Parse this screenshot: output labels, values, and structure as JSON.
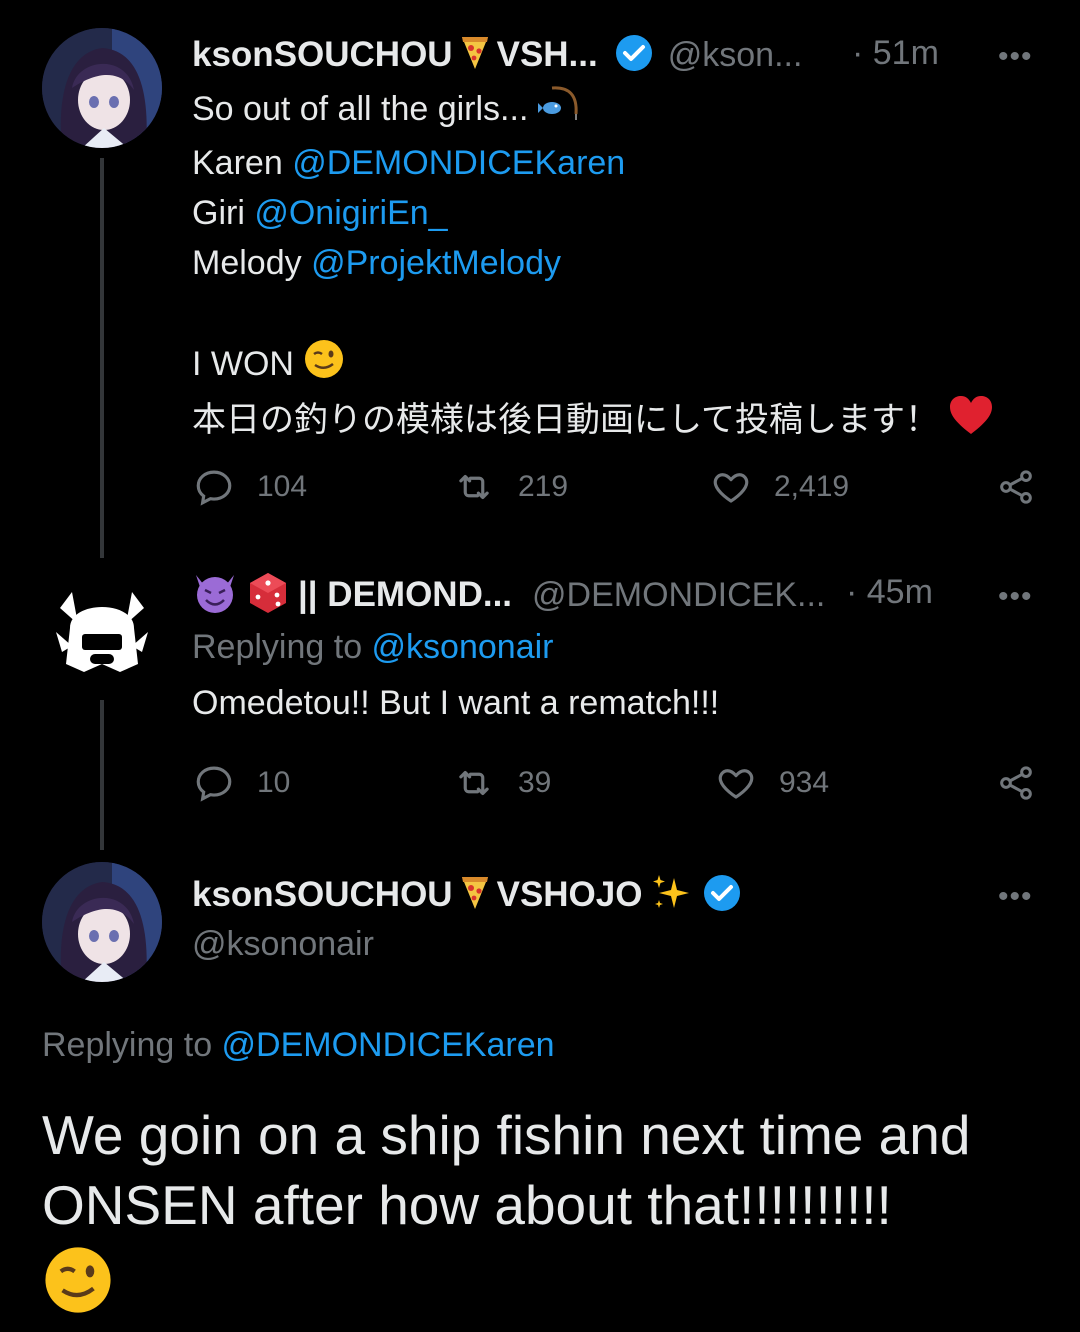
{
  "tweet1": {
    "display_name": "ksonSOUCHOU",
    "display_name_suffix": "VSH...",
    "handle": "@kson...",
    "time": "· 51m",
    "more": "•••",
    "lines": [
      {
        "text": "So out of all the girls...",
        "mention": ""
      },
      {
        "text": "Karen ",
        "mention": "@DEMONDICEKaren"
      },
      {
        "text": "Giri ",
        "mention": "@OnigiriEn_"
      },
      {
        "text": "Melody ",
        "mention": "@ProjektMelody"
      },
      {
        "text": "I WON",
        "mention": ""
      },
      {
        "text": "本日の釣りの模様は後日動画にして投稿します！",
        "mention": ""
      }
    ],
    "stats": {
      "replies": "104",
      "retweets": "219",
      "likes": "2,419"
    }
  },
  "tweet2": {
    "display_name": "|| DEMOND...",
    "handle": "@DEMONDICEK...",
    "time": "· 45m",
    "more": "•••",
    "replying_label": "Replying to ",
    "replying_to": "@ksononair",
    "text": "Omedetou!! But I want a rematch!!!",
    "stats": {
      "replies": "10",
      "retweets": "39",
      "likes": "934"
    }
  },
  "tweet3": {
    "display_name": "ksonSOUCHOU",
    "display_name_suffix": "VSHOJO",
    "handle": "@ksononair",
    "more": "•••",
    "replying_label": "Replying to ",
    "replying_to": "@DEMONDICEKaren",
    "text_line1": "We goin on a ship fishin next time and",
    "text_line2": "ONSEN after how about that!!!!!!!!!!"
  },
  "colors": {
    "background": "#000000",
    "text": "#e7e9ea",
    "muted": "#71767b",
    "link": "#1d9bf0",
    "verified": "#1d9bf0",
    "heart": "#f91880"
  },
  "icons": [
    "verified-badge-icon",
    "pizza-emoji-icon",
    "fishing-emoji-icon",
    "wink-emoji-icon",
    "heart-emoji-icon",
    "devil-emoji-icon",
    "die-emoji-icon",
    "sparkles-emoji-icon",
    "reply-icon",
    "retweet-icon",
    "like-icon",
    "share-icon",
    "more-icon"
  ]
}
